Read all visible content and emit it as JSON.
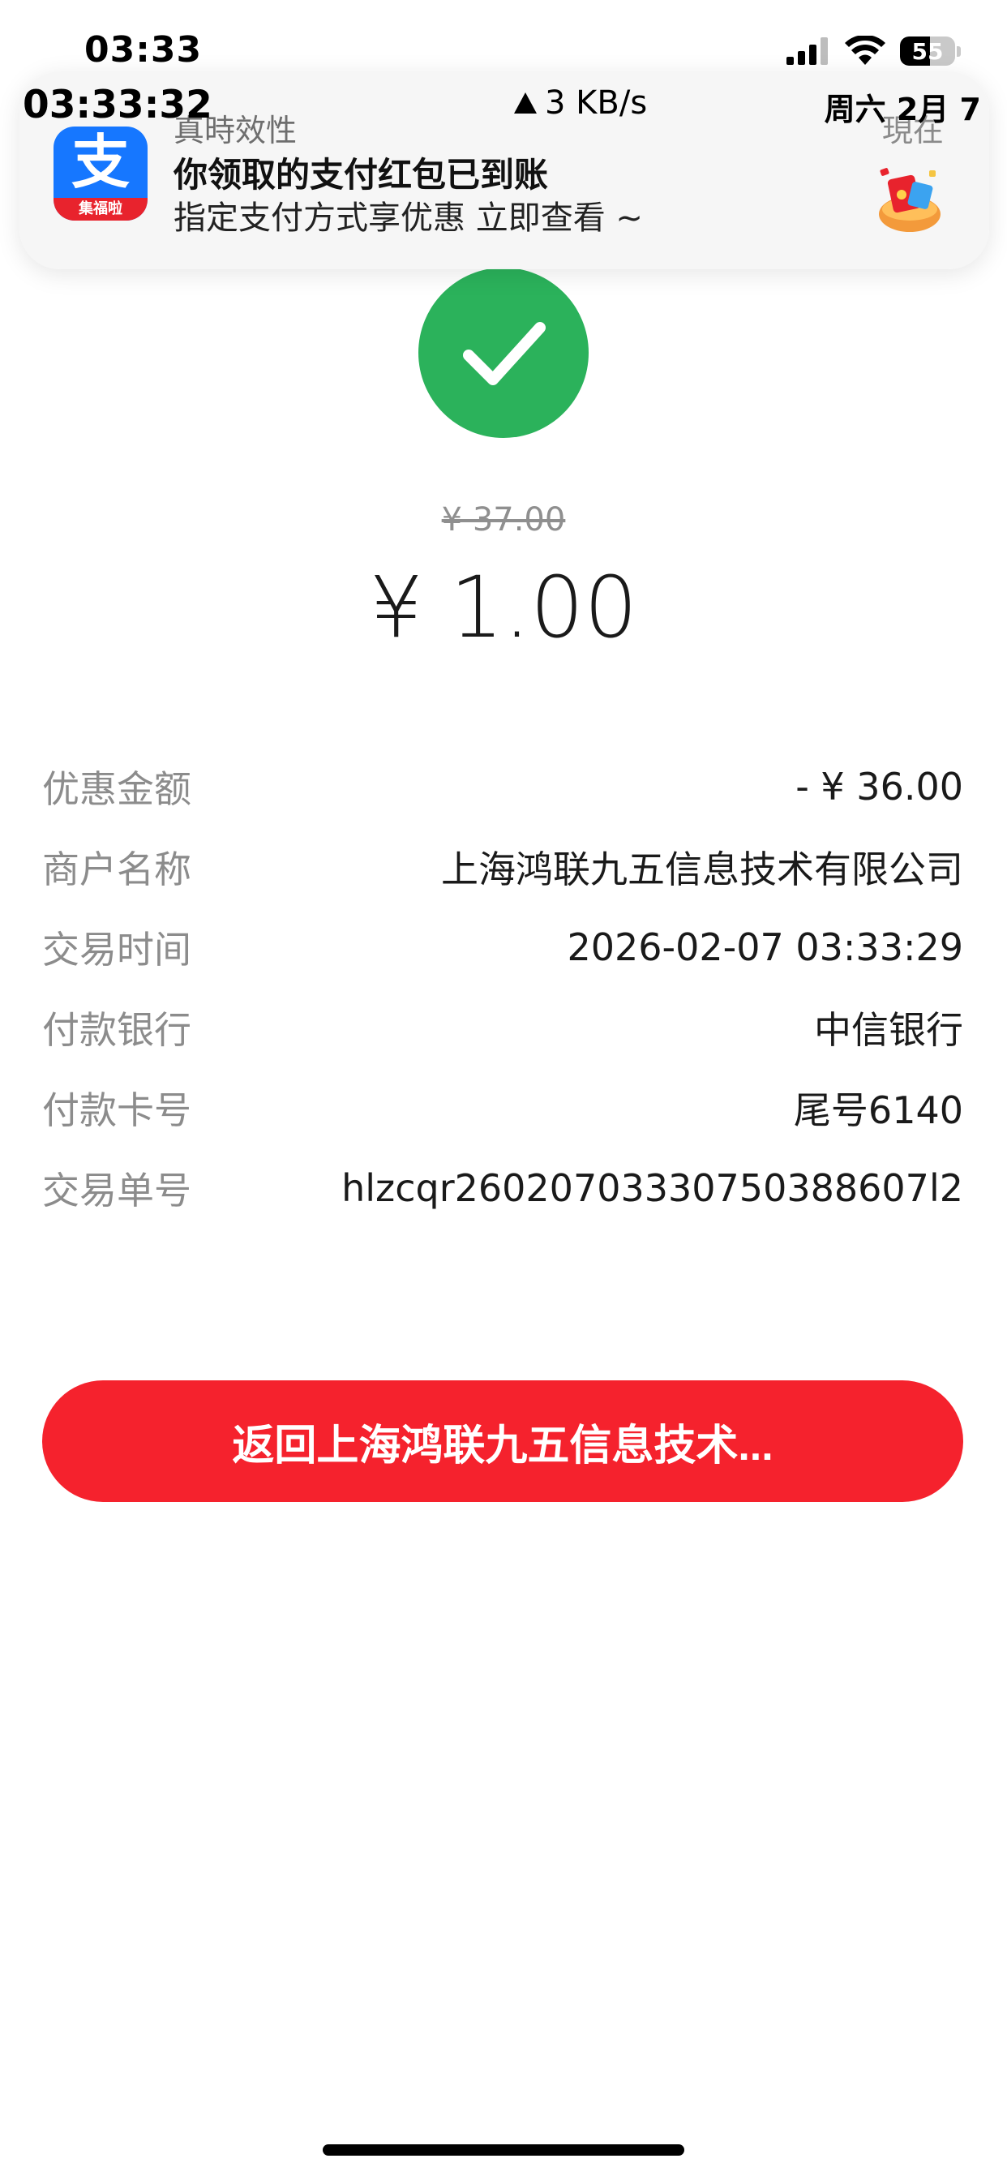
{
  "status_bar": {
    "time": "03:33",
    "battery_level": "55",
    "battery_fraction": 0.55
  },
  "overlay": {
    "clock": "03:33:32",
    "speed": "3 KB/s",
    "date": "周六 2月 7"
  },
  "notification": {
    "app_icon_glyph": "支",
    "app_icon_badge": "集福啦",
    "app_name": "真時效性",
    "time": "現在",
    "title": "你领取的支付红包已到账",
    "body": "指定支付方式享优惠  立即查看 ~"
  },
  "payment": {
    "original_price": "¥ 37.00",
    "amount": "¥ 1.00"
  },
  "details": [
    {
      "label": "优惠金额",
      "value": "- ¥ 36.00"
    },
    {
      "label": "商户名称",
      "value": "上海鸿联九五信息技术有限公司"
    },
    {
      "label": "交易时间",
      "value": "2026-02-07 03:33:29"
    },
    {
      "label": "付款银行",
      "value": "中信银行"
    },
    {
      "label": "付款卡号",
      "value": "尾号6140"
    },
    {
      "label": "交易单号",
      "value": "hlzcqr26020703330750388607l2"
    }
  ],
  "return_button": {
    "label": "返回上海鸿联九五信息技术..."
  },
  "colors": {
    "success_green": "#2bb25b",
    "button_red": "#f5222d",
    "alipay_blue": "#1677ff"
  }
}
